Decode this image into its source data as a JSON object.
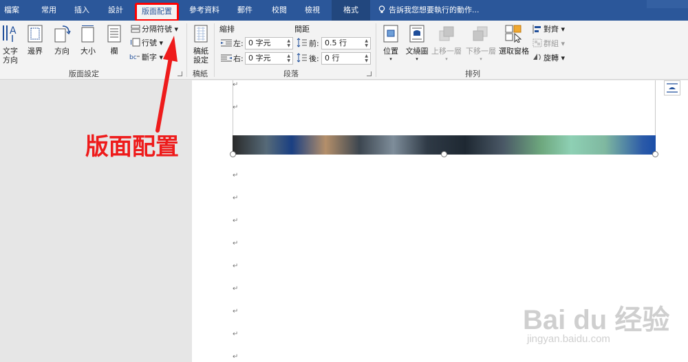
{
  "tabs": [
    {
      "label": "檔案"
    },
    {
      "label": "常用"
    },
    {
      "label": "插入"
    },
    {
      "label": "設計"
    },
    {
      "label": "版面配置"
    },
    {
      "label": "參考資料"
    },
    {
      "label": "郵件"
    },
    {
      "label": "校閱"
    },
    {
      "label": "檢視"
    },
    {
      "label": "格式"
    }
  ],
  "tell_me": "告訴我您想要執行的動作...",
  "ribbon": {
    "page_setup": {
      "text_direction": "文字方向",
      "margins": "邊界",
      "orientation": "方向",
      "size": "大小",
      "columns": "欄",
      "breaks": "分隔符號",
      "line_numbers": "行號",
      "hyphenation": "斷字",
      "group_label": "版面設定"
    },
    "draft": {
      "draft_paper": "稿紙設定",
      "group_label": "稿紙"
    },
    "paragraph": {
      "indent_header": "縮排",
      "spacing_header": "間距",
      "left_label": "左:",
      "left_value": "0 字元",
      "right_label": "右:",
      "right_value": "0 字元",
      "before_label": "前:",
      "before_value": "0.5 行",
      "after_label": "後:",
      "after_value": "0 行",
      "group_label": "段落"
    },
    "arrange": {
      "position": "位置",
      "wrap_text": "文繞圖",
      "bring_forward": "上移一層",
      "send_backward": "下移一層",
      "selection_pane": "選取窗格",
      "align": "對齊",
      "group": "群組",
      "rotate": "旋轉",
      "group_label": "排列"
    }
  },
  "annotation": {
    "text": "版面配置",
    "color": "#ee1b1b"
  },
  "watermark": {
    "logo": "Bai du 经验",
    "url": "jingyan.baidu.com"
  },
  "colors": {
    "tab_bar": "#2b579a",
    "ribbon": "#f3f3f3",
    "highlight": "#ff0000"
  }
}
